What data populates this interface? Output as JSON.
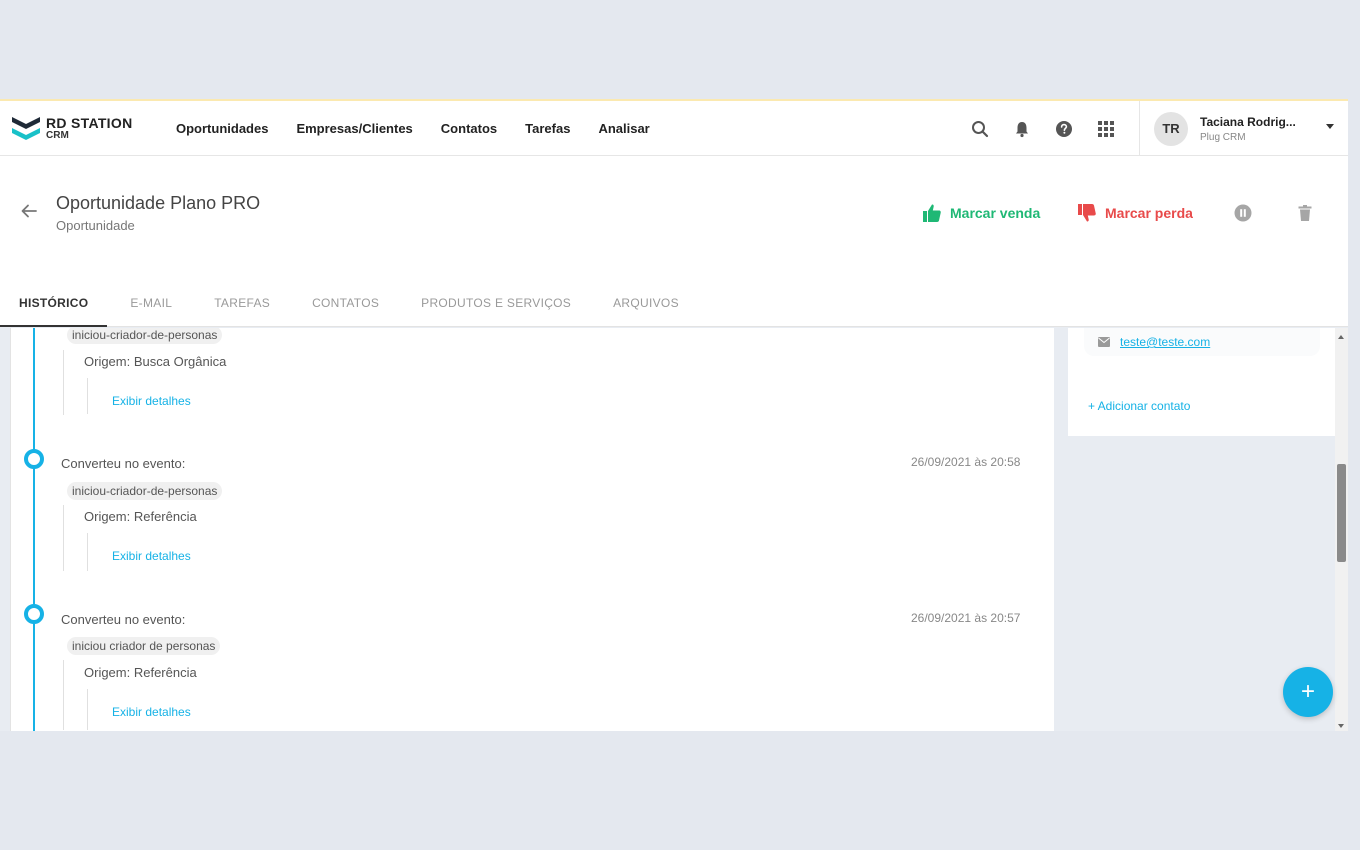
{
  "brand": {
    "name": "RD STATION",
    "product": "CRM",
    "colors": {
      "accent": "#16b2e6",
      "win": "#1fb875",
      "lose": "#e84a4a"
    }
  },
  "nav": {
    "menu": [
      "Oportunidades",
      "Empresas/Clientes",
      "Contatos",
      "Tarefas",
      "Analisar"
    ],
    "icons": [
      "search-icon",
      "bell-icon",
      "help-icon",
      "apps-grid-icon"
    ]
  },
  "user": {
    "initials": "TR",
    "name": "Taciana Rodrig...",
    "org": "Plug CRM"
  },
  "deal": {
    "title": "Oportunidade Plano PRO",
    "subtitle": "Oportunidade",
    "actions": {
      "win": "Marcar venda",
      "lose": "Marcar perda"
    }
  },
  "tabs": [
    "HISTÓRICO",
    "E-MAIL",
    "TAREFAS",
    "CONTATOS",
    "PRODUTOS E SERVIÇOS",
    "ARQUIVOS"
  ],
  "timeline": {
    "partial": {
      "tag": "iniciou-criador-de-personas",
      "origin": "Origem: Busca Orgânica",
      "link": "Exibir detalhes"
    },
    "events": [
      {
        "title": "Converteu no evento:",
        "date": "26/09/2021 às 20:58",
        "tag": "iniciou-criador-de-personas",
        "origin": "Origem: Referência",
        "link": "Exibir detalhes"
      },
      {
        "title": "Converteu no evento:",
        "date": "26/09/2021 às 20:57",
        "tag": "iniciou criador de personas",
        "origin": "Origem: Referência",
        "link": "Exibir detalhes"
      }
    ]
  },
  "contact_panel": {
    "email": "teste@teste.com",
    "add_contact": "+ Adicionar contato"
  },
  "fab": {
    "label": "+"
  }
}
